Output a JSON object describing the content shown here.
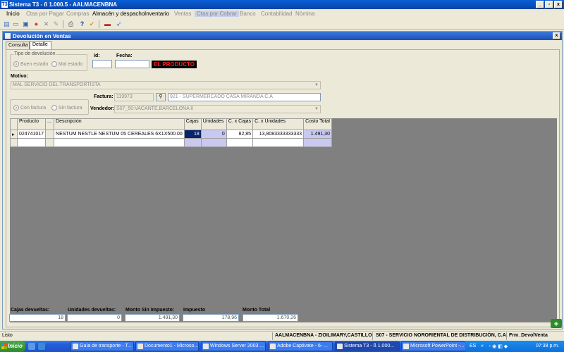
{
  "window": {
    "title": "Sistema T3 - ß 1.000.5 - AALMACENBNA",
    "app_icon": "T3"
  },
  "window_buttons": [
    "_",
    "▫",
    "x"
  ],
  "menu": [
    {
      "label": "Inicio",
      "state": "enabled"
    },
    {
      "label": "Ctas por Pagar",
      "state": "disabled"
    },
    {
      "label": "Compras",
      "state": "disabled"
    },
    {
      "label": "Almacén y despacho",
      "state": "enabled"
    },
    {
      "label": "Inventario",
      "state": "enabled"
    },
    {
      "label": "Ventas",
      "state": "disabled"
    },
    {
      "label": "Ctas por Cobrar",
      "state": "selected"
    },
    {
      "label": "Banco",
      "state": "disabled"
    },
    {
      "label": "Contabilidad",
      "state": "disabled"
    },
    {
      "label": "Nómina",
      "state": "disabled"
    }
  ],
  "toolbar_icons": [
    "new-doc-icon",
    "open-icon",
    "save-icon",
    "record-icon",
    "delete-icon",
    "edit-icon",
    "print-icon",
    "help-icon",
    "filter-icon",
    "dash-icon",
    "rocket-icon"
  ],
  "child": {
    "title": "Devolución en Ventas",
    "close": "x"
  },
  "tabs": [
    {
      "label": "Consulta",
      "active": false
    },
    {
      "label": "Detalle",
      "active": true
    }
  ],
  "form": {
    "tipo_legend": "Tipo de devolución",
    "buen_estado": "Buen estado",
    "mal_estado": "Mal estado",
    "id_label": "Id:",
    "id_value": "",
    "fecha_label": "Fecha:",
    "fecha_value": "",
    "alert": "EL PRODUCTO",
    "motivo_label": "Motivo:",
    "motivo_value": "MAL SERVICIO DEL TRANSPORTISTA",
    "con_factura": "Con factura",
    "sin_factura": "Sin factura",
    "factura_label": "Factura:",
    "factura_value": "119973",
    "cliente_value": "921 - SUPERMERCADO CASA MIRANDA C.A",
    "vendedor_label": "Vendedor:",
    "vendedor_value": "S07_50:VACANTE,BARCELONA II"
  },
  "grid": {
    "headers": [
      "Producto",
      "...",
      "Descripción",
      "Cajas",
      "Unidades",
      "C. x Cajas",
      "C. x Unidades",
      "Costo Total"
    ],
    "rows": [
      {
        "marker": "▸",
        "producto": "024741017",
        "descripcion": "NESTUM NESTLE NESTUM 05 CEREALES 6X1X500.00",
        "cajas": "18",
        "unidades": "0",
        "c_cajas": "82,85",
        "c_unidades": "13,8083333333333",
        "costo_total": "1.491,30"
      },
      {
        "marker": "",
        "producto": "",
        "descripcion": "",
        "cajas": "",
        "unidades": "",
        "c_cajas": "",
        "c_unidades": "",
        "costo_total": ""
      }
    ]
  },
  "totals": {
    "cajas_label": "Cajas devueltas:",
    "cajas_value": "18",
    "unidades_label": "Unidades devueltas:",
    "unidades_value": "0",
    "monto_sin_label": "Monto Sin Impuesto:",
    "monto_sin_value": "1.491,30",
    "impuesto_label": "Impuesto",
    "impuesto_value": "178,96",
    "monto_total_label": "Monto Total",
    "monto_total_value": "1.670,26"
  },
  "status": {
    "left": "Listo",
    "user": "AALMACENBNA - ZIOILIMARY,CASTILLO",
    "branch": "S07 - SERVICIO NORORIENTAL DE DISTRIBUCIÓN, C.A.",
    "form": "Frm_DevolVenta"
  },
  "taskbar": {
    "start": "Inicio",
    "tasks": [
      {
        "label": "Guía de transporte - T...",
        "active": false
      },
      {
        "label": "Documento1 - Microso...",
        "active": false
      },
      {
        "label": "Windows Server 2003 ...",
        "active": false
      },
      {
        "label": "Adobe Captivate - 6- ...",
        "active": false
      },
      {
        "label": "Sistema T3 - ß 1.000...",
        "active": true
      },
      {
        "label": "Microsoft PowerPoint -...",
        "active": false
      }
    ],
    "lang": "ES",
    "clock": "07:38 p.m."
  }
}
